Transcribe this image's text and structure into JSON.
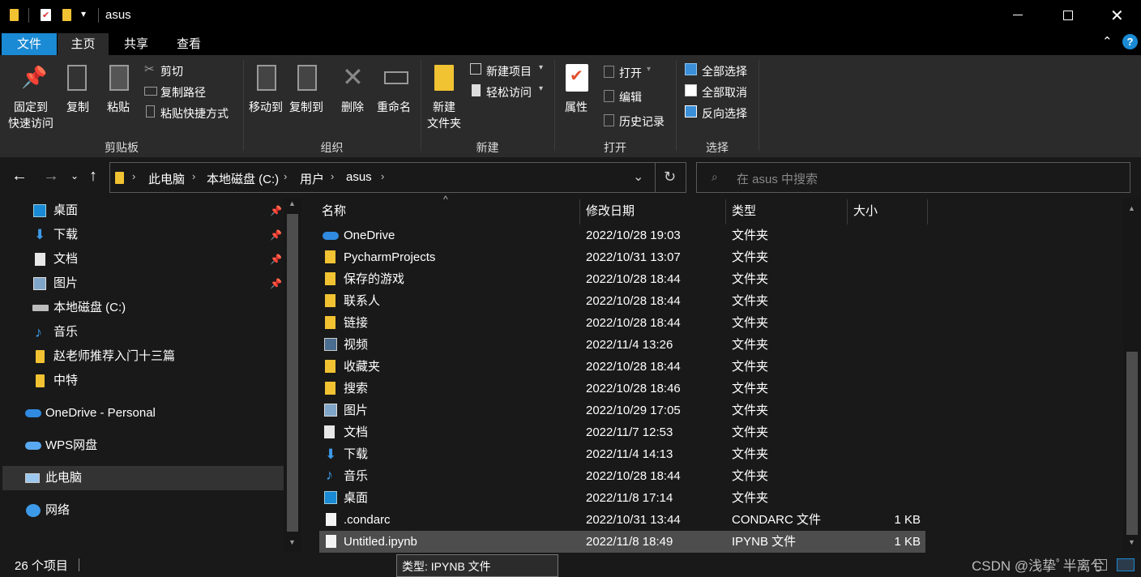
{
  "window": {
    "title": "asus"
  },
  "tabs": [
    "文件",
    "主页",
    "共享",
    "查看"
  ],
  "ribbon": {
    "clipboard": {
      "pin_label_1": "固定到",
      "pin_label_2": "快速访问",
      "copy": "复制",
      "paste": "粘贴",
      "cut": "剪切",
      "copy_path": "复制路径",
      "paste_shortcut": "粘贴快捷方式",
      "group": "剪贴板"
    },
    "organize": {
      "move_to": "移动到",
      "copy_to": "复制到",
      "delete": "删除",
      "rename": "重命名",
      "group": "组织"
    },
    "new": {
      "new_folder_1": "新建",
      "new_folder_2": "文件夹",
      "new_item": "新建项目",
      "easy_access": "轻松访问",
      "group": "新建"
    },
    "open": {
      "properties": "属性",
      "open": "打开",
      "edit": "编辑",
      "history": "历史记录",
      "group": "打开"
    },
    "select": {
      "select_all": "全部选择",
      "select_none": "全部取消",
      "invert": "反向选择",
      "group": "选择"
    }
  },
  "address": {
    "crumbs": [
      "此电脑",
      "本地磁盘 (C:)",
      "用户",
      "asus"
    ],
    "search_placeholder": "在 asus 中搜索"
  },
  "nav": [
    {
      "label": "桌面",
      "icon": "desktop-icon",
      "pinned": true
    },
    {
      "label": "下载",
      "icon": "download-icon",
      "pinned": true
    },
    {
      "label": "文档",
      "icon": "document-icon",
      "pinned": true
    },
    {
      "label": "图片",
      "icon": "pictures-icon",
      "pinned": true
    },
    {
      "label": "本地磁盘 (C:)",
      "icon": "drive-icon",
      "pinned": false
    },
    {
      "label": "音乐",
      "icon": "music-icon",
      "pinned": false
    },
    {
      "label": "赵老师推荐入门十三篇",
      "icon": "folder-icon",
      "pinned": false
    },
    {
      "label": "中特",
      "icon": "folder-icon",
      "pinned": false
    },
    {
      "label": "OneDrive - Personal",
      "icon": "cloud-icon",
      "pinned": false
    },
    {
      "label": "WPS网盘",
      "icon": "cloud-icon",
      "pinned": false
    },
    {
      "label": "此电脑",
      "icon": "computer-icon",
      "pinned": false
    },
    {
      "label": "网络",
      "icon": "network-icon",
      "pinned": false
    }
  ],
  "columns": {
    "name": "名称",
    "date": "修改日期",
    "type": "类型",
    "size": "大小"
  },
  "files": [
    {
      "name": "OneDrive",
      "date": "2022/10/28 19:03",
      "type": "文件夹",
      "size": "",
      "icon": "cloud-icon"
    },
    {
      "name": "PycharmProjects",
      "date": "2022/10/31 13:07",
      "type": "文件夹",
      "size": "",
      "icon": "folder-icon"
    },
    {
      "name": "保存的游戏",
      "date": "2022/10/28 18:44",
      "type": "文件夹",
      "size": "",
      "icon": "folder-icon"
    },
    {
      "name": "联系人",
      "date": "2022/10/28 18:44",
      "type": "文件夹",
      "size": "",
      "icon": "folder-icon"
    },
    {
      "name": "链接",
      "date": "2022/10/28 18:44",
      "type": "文件夹",
      "size": "",
      "icon": "folder-icon"
    },
    {
      "name": "视频",
      "date": "2022/11/4 13:26",
      "type": "文件夹",
      "size": "",
      "icon": "video-icon"
    },
    {
      "name": "收藏夹",
      "date": "2022/10/28 18:44",
      "type": "文件夹",
      "size": "",
      "icon": "folder-icon"
    },
    {
      "name": "搜索",
      "date": "2022/10/28 18:46",
      "type": "文件夹",
      "size": "",
      "icon": "folder-icon"
    },
    {
      "name": "图片",
      "date": "2022/10/29 17:05",
      "type": "文件夹",
      "size": "",
      "icon": "pictures-icon"
    },
    {
      "name": "文档",
      "date": "2022/11/7 12:53",
      "type": "文件夹",
      "size": "",
      "icon": "document-icon"
    },
    {
      "name": "下载",
      "date": "2022/11/4 14:13",
      "type": "文件夹",
      "size": "",
      "icon": "download-icon"
    },
    {
      "name": "音乐",
      "date": "2022/10/28 18:44",
      "type": "文件夹",
      "size": "",
      "icon": "music-icon"
    },
    {
      "name": "桌面",
      "date": "2022/11/8 17:14",
      "type": "文件夹",
      "size": "",
      "icon": "desktop-icon"
    },
    {
      "name": ".condarc",
      "date": "2022/10/31 13:44",
      "type": "CONDARC 文件",
      "size": "1 KB",
      "icon": "file-icon"
    },
    {
      "name": "Untitled.ipynb",
      "date": "2022/11/8 18:49",
      "type": "IPYNB 文件",
      "size": "1 KB",
      "icon": "file-icon"
    }
  ],
  "status": {
    "count": "26 个项目"
  },
  "tooltip": {
    "line1": "类型: IPYNB 文件"
  },
  "watermark": "CSDN @浅挚ﾟ半离兮",
  "colors": {
    "accent": "#1a8ad4",
    "folder": "#f1c232",
    "selected_row": "#4d4d4d"
  }
}
